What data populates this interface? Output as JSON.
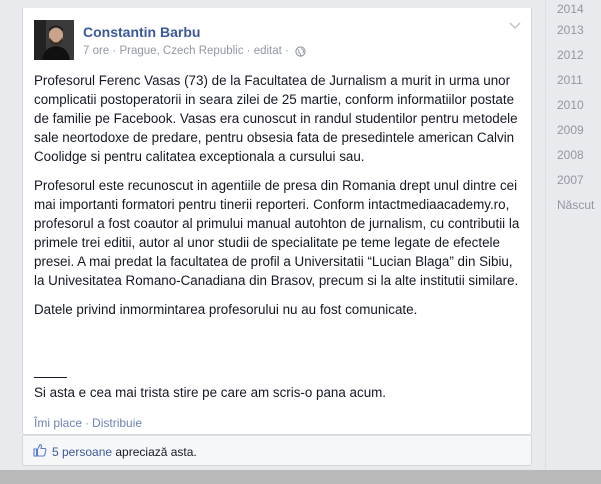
{
  "post": {
    "author": "Constantin Barbu",
    "time": "7 ore",
    "location": "Prague, Czech Republic",
    "edited": "editat",
    "paragraphs": [
      "Profesorul Ferenc Vasas (73) de la Facultatea de Jurnalism a murit in urma unor complicatii postoperatorii in seara zilei de 25 martie, conform informatiilor postate de familie pe Facebook. Vasas era cunoscut in randul studentilor pentru metodele sale neortodoxe de predare, pentru obsesia fata de presedintele american Calvin Coolidge si pentru calitatea exceptionala a cursului sau.",
      "Profesorul este recunoscut in agentiile de presa din Romania drept unul dintre cei mai importanti formatori pentru tinerii reporteri. Conform intactmediaacademy.ro, profesorul a fost coautor al primului manual autohton de jurnalism, cu contributii la primele trei editii, autor al unor studii de specialitate pe teme legate de efectele presei. A mai predat la facultatea de profil a Universitatii “Lucian Blaga” din Sibiu, la Univesitatea Romano-Canadiana din Brasov, precum si la alte institutii similare.",
      "Datele privind inmormintarea profesorului nu au fost comunicate."
    ],
    "final_line": "Si asta e cea mai trista stire pe care am scris-o pana acum.",
    "actions": {
      "like": "Îmi place",
      "share": "Distribuie"
    },
    "likes": {
      "count": "5 persoane",
      "text": " apreciază asta."
    }
  },
  "timeline": {
    "years": [
      "2014",
      "2013",
      "2012",
      "2011",
      "2010",
      "2009",
      "2008",
      "2007",
      "Născut"
    ]
  },
  "colors": {
    "link": "#3b5998",
    "meta": "#9197a3",
    "background": "#e9eaed"
  }
}
